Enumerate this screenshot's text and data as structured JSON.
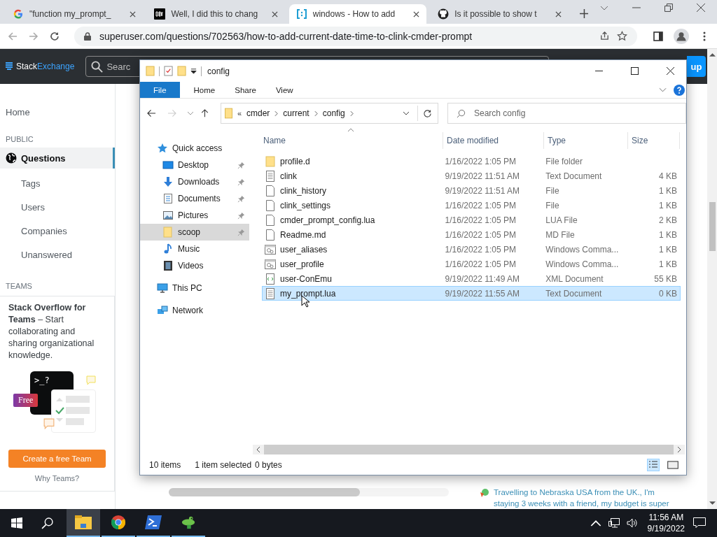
{
  "browser": {
    "tabs": [
      {
        "title": "\"function my_prompt_",
        "kind": "google",
        "selected": false
      },
      {
        "title": "Well, I did this to chang",
        "kind": "dev",
        "selected": false
      },
      {
        "title": "windows - How to add",
        "kind": "superuser",
        "selected": true
      },
      {
        "title": "Is it possible to show t",
        "kind": "github",
        "selected": false
      }
    ],
    "url": "superuser.com/questions/702563/how-to-add-current-date-time-to-clink-cmder-prompt"
  },
  "site": {
    "logo": [
      "Stack",
      "Exchange"
    ],
    "search": "Searc",
    "signup_button": "up",
    "sidebar": {
      "home": "Home",
      "public": "PUBLIC",
      "items": [
        {
          "label": "Questions",
          "selected": true
        },
        {
          "label": "Tags",
          "selected": false
        },
        {
          "label": "Users",
          "selected": false
        },
        {
          "label": "Companies",
          "selected": false
        },
        {
          "label": "Unanswered",
          "selected": false
        }
      ],
      "teams": "TEAMS",
      "teams_text": "**Stack Overflow for Teams** – Start collaborating and sharing organizational knowledge.",
      "prompt_text": ">_?",
      "badge": "Free",
      "create_button": "Create a free Team",
      "why_link": "Why Teams?"
    },
    "hot_question": "Travelling to Nebraska USA from the UK., I'm staying 3 weeks with a friend, my budget is super"
  },
  "explorer": {
    "title": "config",
    "file_menu": "File",
    "ribbon_tabs": [
      "Home",
      "Share",
      "View"
    ],
    "breadcrumb": [
      "cmder",
      "current",
      "config"
    ],
    "overflow": "«",
    "search_placeholder": "Search config",
    "nav": [
      {
        "label": "Quick access",
        "kind": "star",
        "selected": false,
        "children": [
          {
            "label": "Desktop",
            "kind": "desktop",
            "pinned": true,
            "selected": false
          },
          {
            "label": "Downloads",
            "kind": "download",
            "pinned": true,
            "selected": false
          },
          {
            "label": "Documents",
            "kind": "document",
            "pinned": true,
            "selected": false
          },
          {
            "label": "Pictures",
            "kind": "pictures",
            "pinned": true,
            "selected": false
          },
          {
            "label": "scoop",
            "kind": "folder",
            "pinned": true,
            "selected": true
          },
          {
            "label": "Music",
            "kind": "music",
            "pinned": false,
            "selected": false
          },
          {
            "label": "Videos",
            "kind": "video",
            "pinned": false,
            "selected": false
          }
        ]
      },
      {
        "label": "This PC",
        "kind": "pc",
        "selected": false
      },
      {
        "label": "Network",
        "kind": "network",
        "selected": false
      }
    ],
    "columns": [
      "Name",
      "Date modified",
      "Type",
      "Size"
    ],
    "files": [
      {
        "name": "profile.d",
        "date": "1/16/2022 1:05 PM",
        "type": "File folder",
        "kind": "folder",
        "selected": false
      },
      {
        "name": "clink",
        "date": "9/19/2022 11:51 AM",
        "type": "Text Document",
        "size": "4 KB",
        "kind": "text",
        "selected": false
      },
      {
        "name": "clink_history",
        "date": "9/19/2022 11:51 AM",
        "type": "File",
        "size": "1 KB",
        "kind": "file",
        "selected": false
      },
      {
        "name": "clink_settings",
        "date": "1/16/2022 1:05 PM",
        "type": "File",
        "size": "1 KB",
        "kind": "file",
        "selected": false
      },
      {
        "name": "cmder_prompt_config.lua",
        "date": "1/16/2022 1:05 PM",
        "type": "LUA File",
        "size": "2 KB",
        "kind": "file",
        "selected": false
      },
      {
        "name": "Readme.md",
        "date": "1/16/2022 1:05 PM",
        "type": "MD File",
        "size": "1 KB",
        "kind": "file",
        "selected": false
      },
      {
        "name": "user_aliases",
        "date": "1/16/2022 1:05 PM",
        "type": "Windows Comma...",
        "size": "1 KB",
        "kind": "cmd",
        "selected": false
      },
      {
        "name": "user_profile",
        "date": "1/16/2022 1:05 PM",
        "type": "Windows Comma...",
        "size": "1 KB",
        "kind": "cmd",
        "selected": false
      },
      {
        "name": "user-ConEmu",
        "date": "9/19/2022 11:49 AM",
        "type": "XML Document",
        "size": "55 KB",
        "kind": "xml",
        "selected": false
      },
      {
        "name": "my_prompt.lua",
        "date": "9/19/2022 11:55 AM",
        "type": "Text Document",
        "size": "0 KB",
        "kind": "text",
        "selected": true
      }
    ],
    "status": [
      "10 items",
      "1 item selected",
      "0 bytes"
    ]
  },
  "taskbar": {
    "apps": [
      {
        "kind": "explorer",
        "selected": true
      },
      {
        "kind": "chrome",
        "selected": false
      },
      {
        "kind": "powershell",
        "selected": false
      },
      {
        "kind": "frog",
        "selected": false
      }
    ],
    "time": "11:56 AM",
    "date": "9/19/2022"
  }
}
